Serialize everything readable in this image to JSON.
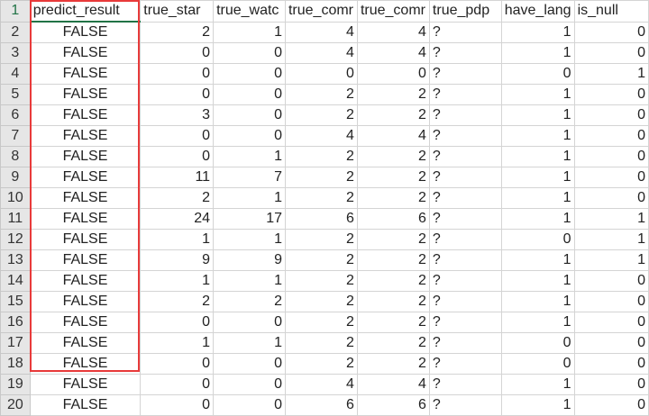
{
  "columns": [
    "predict_result",
    "true_star",
    "true_watc",
    "true_comr",
    "true_comr",
    "true_pdp",
    "have_lang",
    "is_null"
  ],
  "rows": [
    {
      "n": "2",
      "v": [
        "FALSE",
        "2",
        "1",
        "4",
        "4",
        "?",
        "1",
        "0"
      ]
    },
    {
      "n": "3",
      "v": [
        "FALSE",
        "0",
        "0",
        "4",
        "4",
        "?",
        "1",
        "0"
      ]
    },
    {
      "n": "4",
      "v": [
        "FALSE",
        "0",
        "0",
        "0",
        "0",
        "?",
        "0",
        "1"
      ]
    },
    {
      "n": "5",
      "v": [
        "FALSE",
        "0",
        "0",
        "2",
        "2",
        "?",
        "1",
        "0"
      ]
    },
    {
      "n": "6",
      "v": [
        "FALSE",
        "3",
        "0",
        "2",
        "2",
        "?",
        "1",
        "0"
      ]
    },
    {
      "n": "7",
      "v": [
        "FALSE",
        "0",
        "0",
        "4",
        "4",
        "?",
        "1",
        "0"
      ]
    },
    {
      "n": "8",
      "v": [
        "FALSE",
        "0",
        "1",
        "2",
        "2",
        "?",
        "1",
        "0"
      ]
    },
    {
      "n": "9",
      "v": [
        "FALSE",
        "11",
        "7",
        "2",
        "2",
        "?",
        "1",
        "0"
      ]
    },
    {
      "n": "10",
      "v": [
        "FALSE",
        "2",
        "1",
        "2",
        "2",
        "?",
        "1",
        "0"
      ]
    },
    {
      "n": "11",
      "v": [
        "FALSE",
        "24",
        "17",
        "6",
        "6",
        "?",
        "1",
        "1"
      ]
    },
    {
      "n": "12",
      "v": [
        "FALSE",
        "1",
        "1",
        "2",
        "2",
        "?",
        "0",
        "1"
      ]
    },
    {
      "n": "13",
      "v": [
        "FALSE",
        "9",
        "9",
        "2",
        "2",
        "?",
        "1",
        "1"
      ]
    },
    {
      "n": "14",
      "v": [
        "FALSE",
        "1",
        "1",
        "2",
        "2",
        "?",
        "1",
        "0"
      ]
    },
    {
      "n": "15",
      "v": [
        "FALSE",
        "2",
        "2",
        "2",
        "2",
        "?",
        "1",
        "0"
      ]
    },
    {
      "n": "16",
      "v": [
        "FALSE",
        "0",
        "0",
        "2",
        "2",
        "?",
        "1",
        "0"
      ]
    },
    {
      "n": "17",
      "v": [
        "FALSE",
        "1",
        "1",
        "2",
        "2",
        "?",
        "0",
        "0"
      ]
    },
    {
      "n": "18",
      "v": [
        "FALSE",
        "0",
        "0",
        "2",
        "2",
        "?",
        "0",
        "0"
      ]
    },
    {
      "n": "19",
      "v": [
        "FALSE",
        "0",
        "0",
        "4",
        "4",
        "?",
        "1",
        "0"
      ]
    },
    {
      "n": "20",
      "v": [
        "FALSE",
        "0",
        "0",
        "6",
        "6",
        "?",
        "1",
        "0"
      ]
    }
  ],
  "header_row_number": "1",
  "highlight_color": "#e83a3a",
  "selection_color": "#217346"
}
